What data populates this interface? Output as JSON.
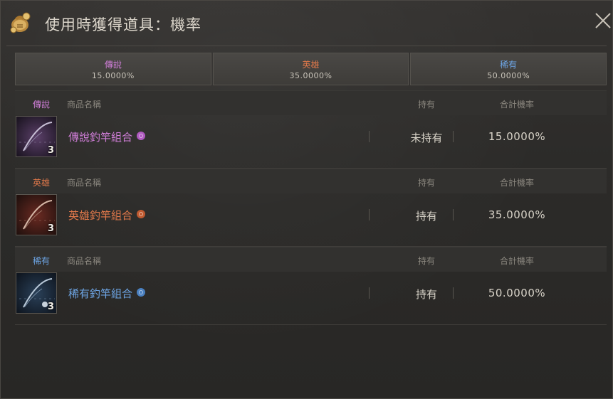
{
  "window": {
    "title": "使用時獲得道具：機率"
  },
  "colors": {
    "legendary": "#d07ed8",
    "heroic": "#e0784a",
    "rare": "#6ea6e6"
  },
  "summary": [
    {
      "grade": "傳說",
      "rate": "15.0000%"
    },
    {
      "grade": "英雄",
      "rate": "35.0000%"
    },
    {
      "grade": "稀有",
      "rate": "50.0000%"
    }
  ],
  "sections": [
    {
      "grade": "傳說",
      "col_name": "商品名稱",
      "col_hold": "持有",
      "col_rate": "合計機率",
      "item": {
        "name": "傳說釣竿組合",
        "count": "3",
        "hold": "未持有",
        "rate": "15.0000%"
      }
    },
    {
      "grade": "英雄",
      "col_name": "商品名稱",
      "col_hold": "持有",
      "col_rate": "合計機率",
      "item": {
        "name": "英雄釣竿組合",
        "count": "3",
        "hold": "持有",
        "rate": "35.0000%"
      }
    },
    {
      "grade": "稀有",
      "col_name": "商品名稱",
      "col_hold": "持有",
      "col_rate": "合計機率",
      "item": {
        "name": "稀有釣竿組合",
        "count": "3",
        "hold": "持有",
        "rate": "50.0000%"
      }
    }
  ],
  "icons": {
    "header": "coin-pouch-icon",
    "close": "close-icon",
    "item": "fishing-rod-icon",
    "info": "info-icon"
  }
}
